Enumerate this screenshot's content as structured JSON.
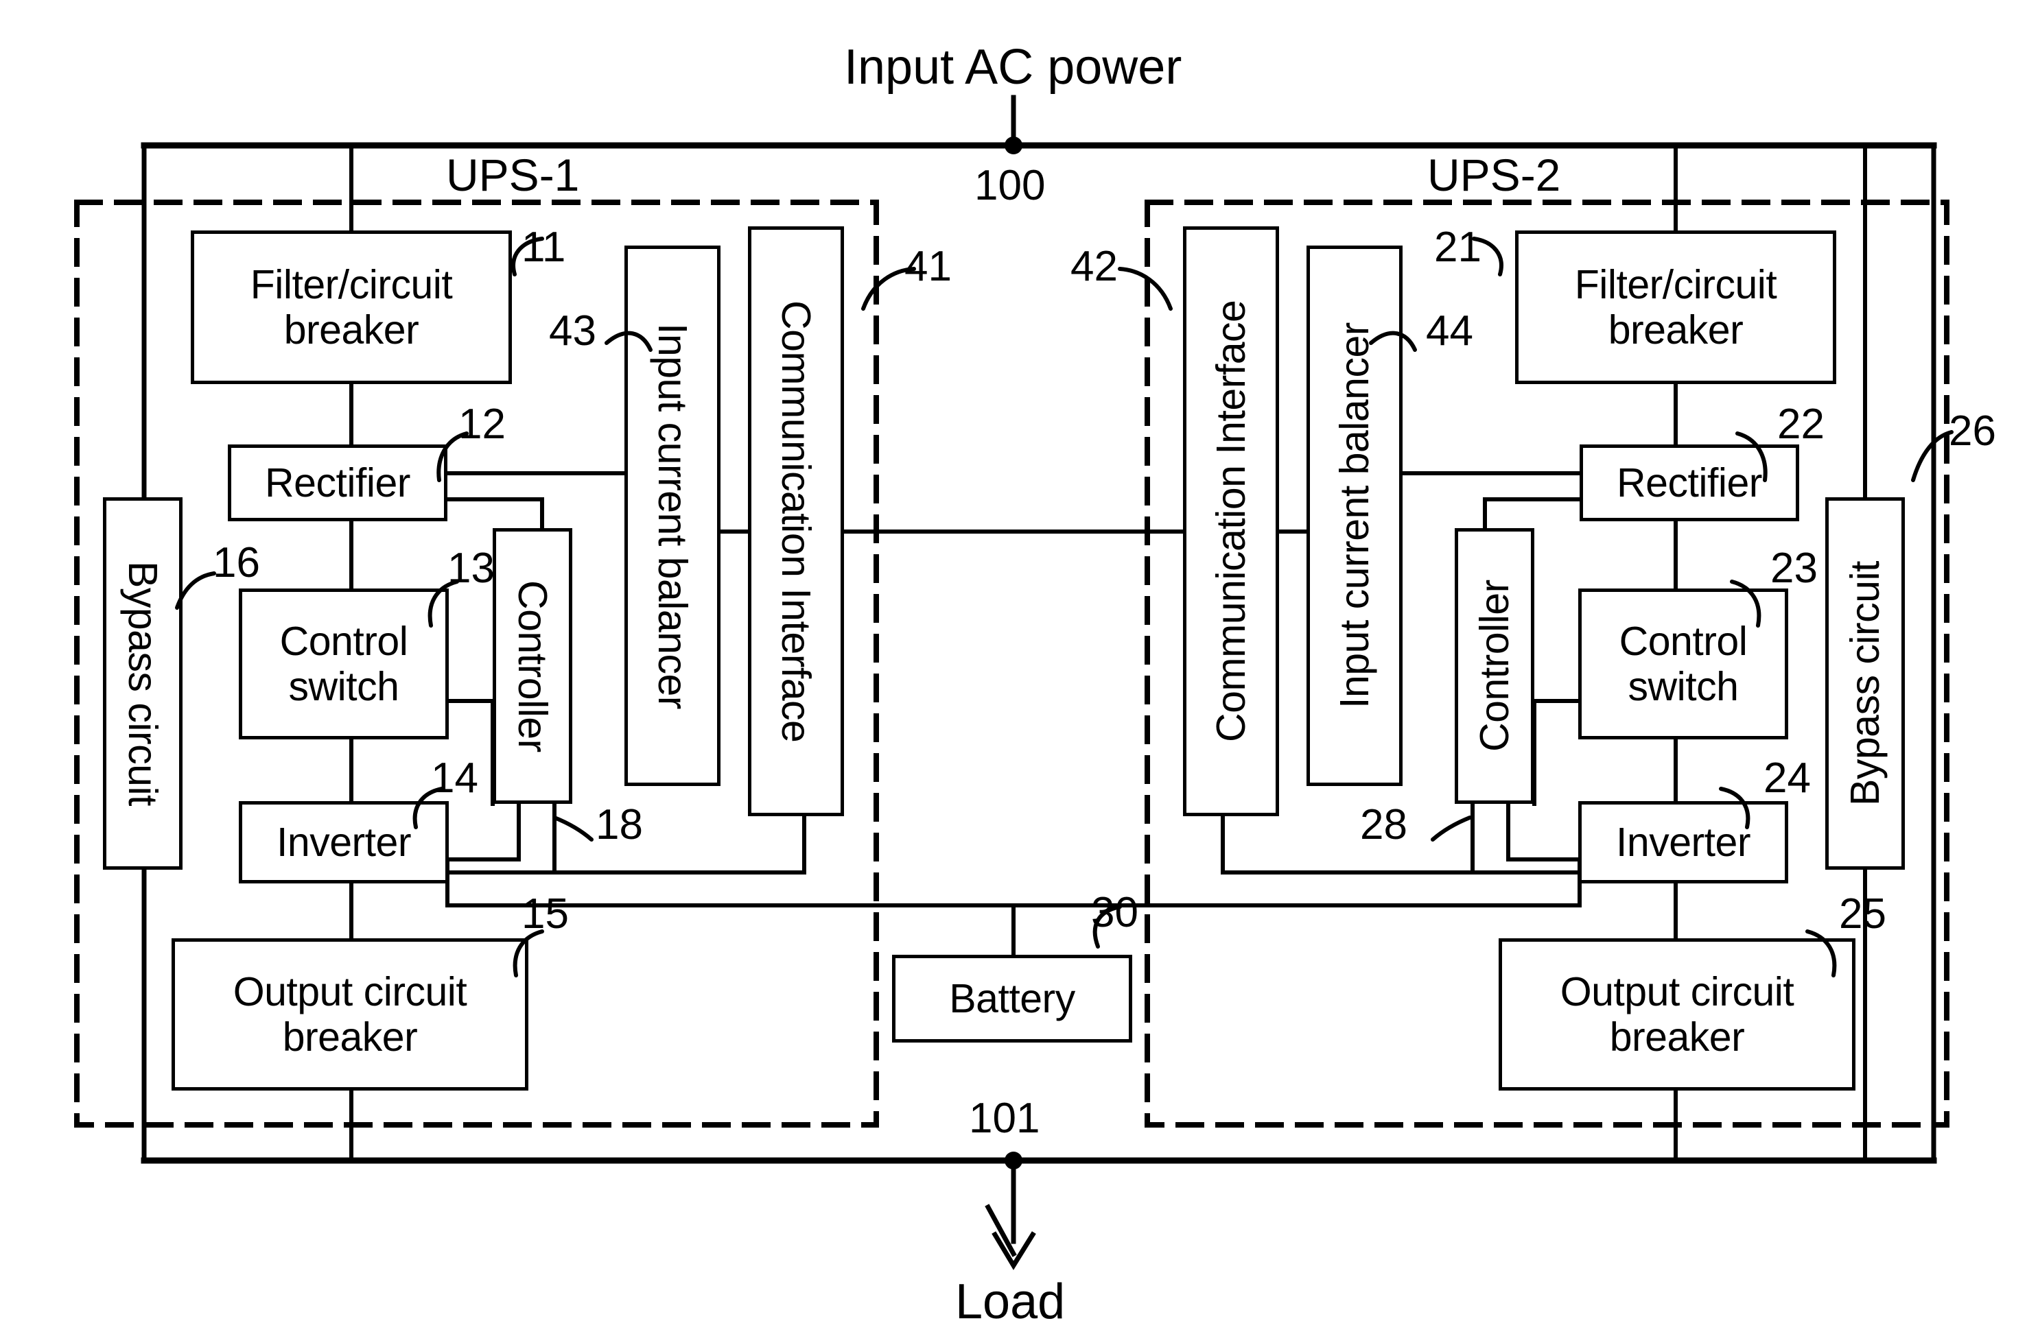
{
  "diagram": {
    "title_top": "Input AC power",
    "title_bottom": "Load",
    "node_top_ref": "100",
    "node_bottom_ref": "101",
    "sections": [
      {
        "name": "UPS-1"
      },
      {
        "name": "UPS-2"
      }
    ],
    "shared": {
      "battery_label": "Battery",
      "battery_ref": "30"
    },
    "ups1": {
      "filter_breaker": {
        "label": "Filter/circuit breaker",
        "ref": "11"
      },
      "rectifier": {
        "label": "Rectifier",
        "ref": "12"
      },
      "control_switch": {
        "label": "Control switch",
        "ref": "13"
      },
      "inverter": {
        "label": "Inverter",
        "ref": "14"
      },
      "output_breaker": {
        "label": "Output circuit breaker",
        "ref": "15"
      },
      "bypass_circuit": {
        "label": "Bypass circuit",
        "ref": "16"
      },
      "controller": {
        "label": "Controller",
        "ref": "18"
      },
      "input_current_balancer": {
        "label": "Input current balancer",
        "ref": "43"
      },
      "communication_interface": {
        "label": "Communication Interface",
        "ref": "41"
      }
    },
    "ups2": {
      "filter_breaker": {
        "label": "Filter/circuit breaker",
        "ref": "21"
      },
      "rectifier": {
        "label": "Rectifier",
        "ref": "22"
      },
      "control_switch": {
        "label": "Control switch",
        "ref": "23"
      },
      "inverter": {
        "label": "Inverter",
        "ref": "24"
      },
      "output_breaker": {
        "label": "Output circuit breaker",
        "ref": "25"
      },
      "bypass_circuit": {
        "label": "Bypass circuit",
        "ref": "26"
      },
      "controller": {
        "label": "Controller",
        "ref": "28"
      },
      "input_current_balancer": {
        "label": "Input current balancer",
        "ref": "44"
      },
      "communication_interface": {
        "label": "Communication Interface",
        "ref": "42"
      }
    },
    "colors": {
      "stroke": "#000000",
      "background": "#ffffff"
    }
  }
}
